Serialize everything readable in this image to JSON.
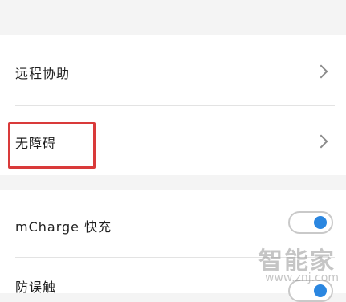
{
  "settings": {
    "group1": [
      {
        "label": "远程协助"
      },
      {
        "label": "无障碍"
      }
    ],
    "group2": [
      {
        "label": "mCharge 快充",
        "toggle": true
      },
      {
        "label": "防误触",
        "toggle": true
      }
    ]
  },
  "watermark": {
    "title": "智能家",
    "url": "www.znj.com"
  },
  "colors": {
    "accent": "#2a86e0",
    "highlight": "#d93a3a",
    "background": "#f4f4f4"
  }
}
